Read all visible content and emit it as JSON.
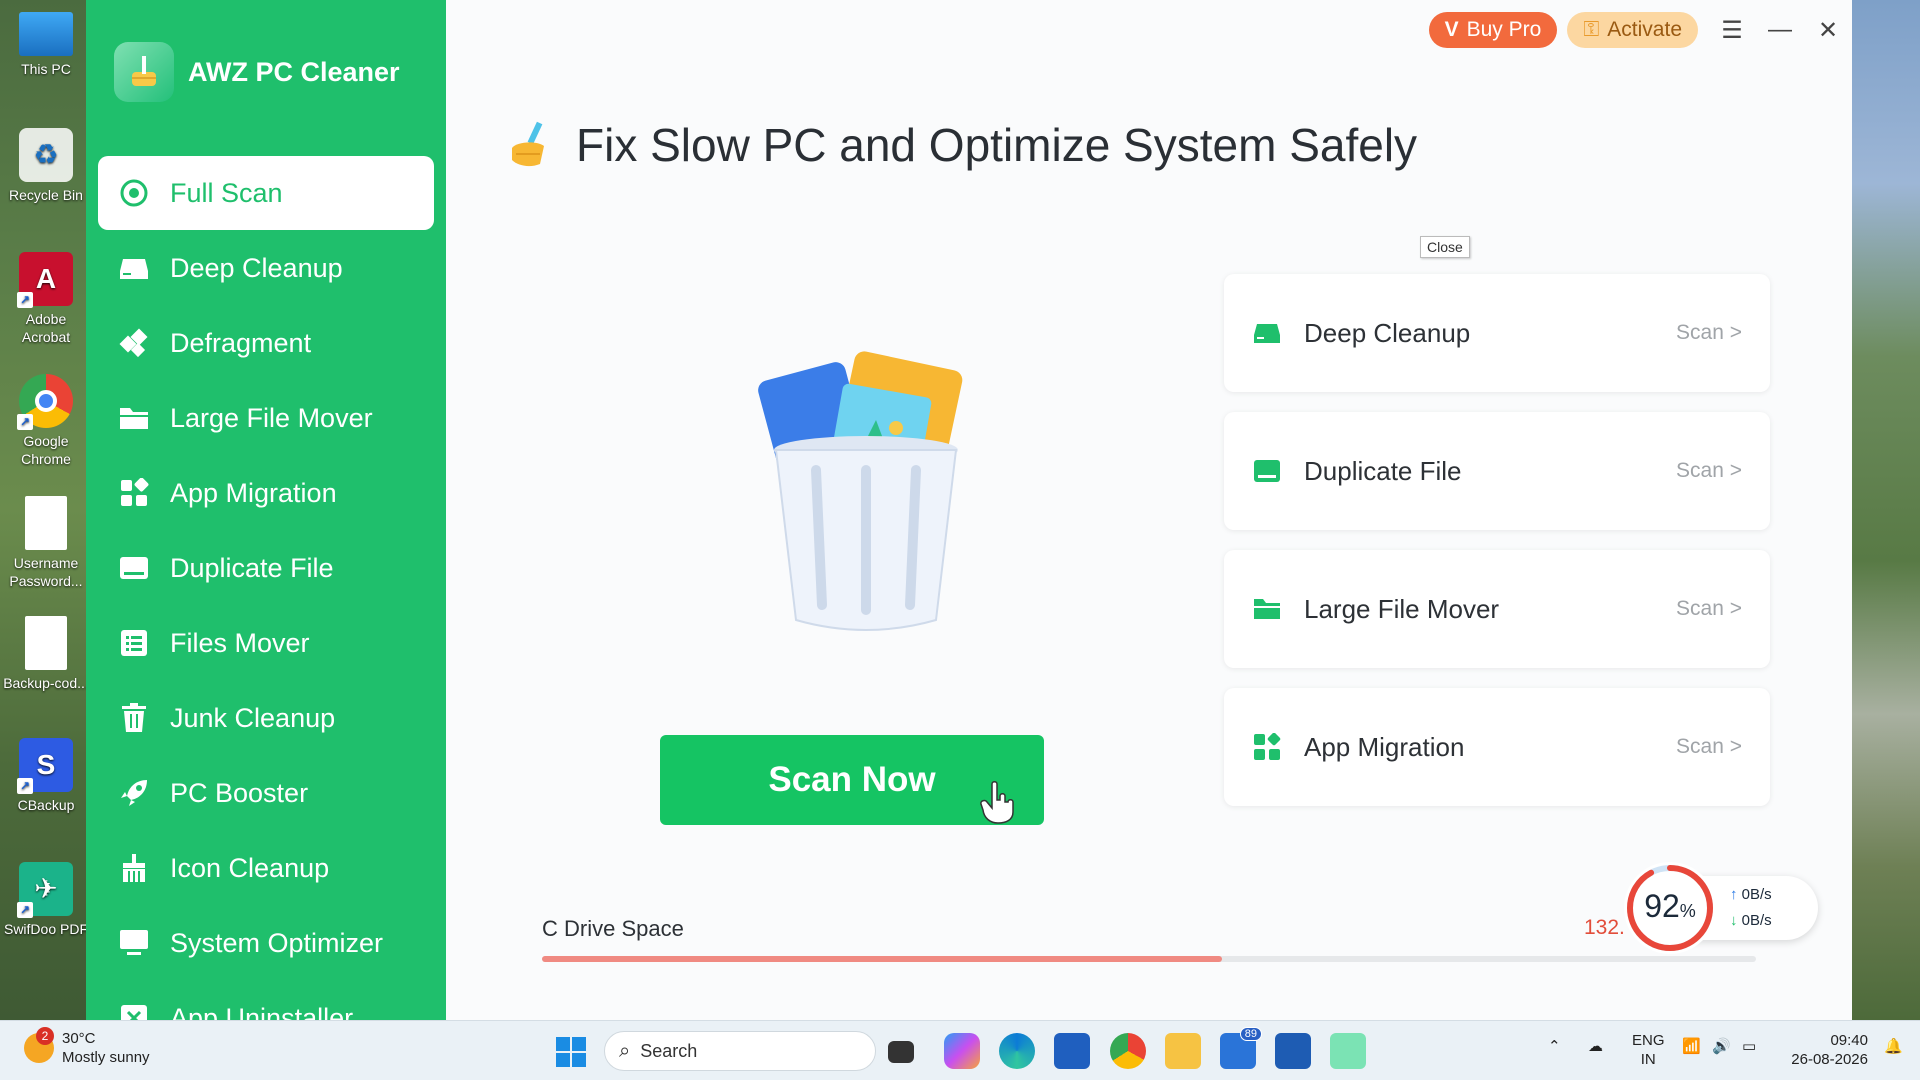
{
  "desktop": {
    "icons": [
      {
        "label": "This PC"
      },
      {
        "label": "Recycle Bin"
      },
      {
        "label": "Adobe Acrobat"
      },
      {
        "label": "Google Chrome"
      },
      {
        "label": "Username Password..."
      },
      {
        "label": "Backup-cod..."
      },
      {
        "label": "CBackup"
      },
      {
        "label": "SwifDoo PDF"
      }
    ]
  },
  "app": {
    "name": "AWZ PC Cleaner",
    "nav": [
      {
        "label": "Full Scan",
        "icon": "full-scan-icon",
        "active": true
      },
      {
        "label": "Deep Cleanup",
        "icon": "drive-icon"
      },
      {
        "label": "Defragment",
        "icon": "puzzle-icon"
      },
      {
        "label": "Large File Mover",
        "icon": "folder-icon"
      },
      {
        "label": "App Migration",
        "icon": "apps-grid-icon"
      },
      {
        "label": "Duplicate File",
        "icon": "duplicate-icon"
      },
      {
        "label": "Files Mover",
        "icon": "list-icon"
      },
      {
        "label": "Junk Cleanup",
        "icon": "trash-icon"
      },
      {
        "label": "PC Booster",
        "icon": "rocket-icon"
      },
      {
        "label": "Icon Cleanup",
        "icon": "broom-icon"
      },
      {
        "label": "System Optimizer",
        "icon": "monitor-icon"
      },
      {
        "label": "App Uninstaller",
        "icon": "uninstall-icon"
      }
    ],
    "topbar": {
      "buy_pro": "Buy Pro",
      "activate": "Activate"
    },
    "headline": "Fix Slow PC and Optimize System Safely",
    "tooltip": "Close",
    "scan_now": "Scan Now",
    "cards": [
      {
        "title": "Deep Cleanup",
        "action": "Scan >",
        "icon": "drive-icon"
      },
      {
        "title": "Duplicate File",
        "action": "Scan >",
        "icon": "duplicate-icon"
      },
      {
        "title": "Large File Mover",
        "action": "Scan >",
        "icon": "folder-icon"
      },
      {
        "title": "App Migration",
        "action": "Scan >",
        "icon": "apps-grid-icon"
      }
    ],
    "drive": {
      "label": "C Drive Space",
      "value_visible": "132.",
      "used_fraction": 0.56
    },
    "monitor": {
      "percent": "92",
      "percent_sign": "%",
      "upload": "0B/s",
      "download": "0B/s"
    },
    "colors": {
      "brand": "#1fbf6c",
      "buy": "#f26a3d",
      "activate": "#fcd7a1",
      "drive_text": "#e24d3a"
    }
  },
  "taskbar": {
    "weather_temp": "30°C",
    "weather_desc": "Mostly sunny",
    "weather_badge": "2",
    "search_placeholder": "Search",
    "mail_badge": "89",
    "lang_line1": "ENG",
    "lang_line2": "IN",
    "time": "09:40",
    "date": "26-08-2026"
  }
}
